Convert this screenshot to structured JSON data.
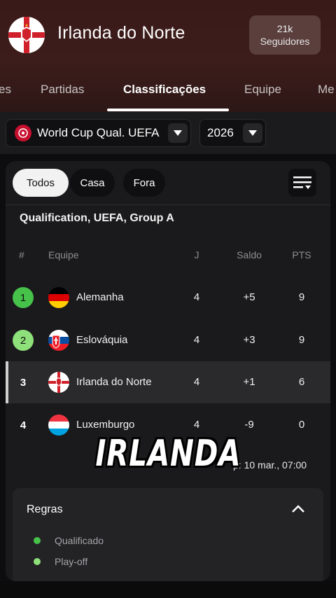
{
  "header": {
    "team_name": "Irlanda do Norte",
    "followers_count": "21k",
    "followers_label": "Seguidores"
  },
  "tabs": [
    {
      "label": "es",
      "active": false
    },
    {
      "label": "Partidas",
      "active": false
    },
    {
      "label": "Classificações",
      "active": true
    },
    {
      "label": "Equipe",
      "active": false
    },
    {
      "label": "Me",
      "active": false
    }
  ],
  "filters": {
    "competition": "World Cup Qual. UEFA",
    "season": "2026"
  },
  "chips": [
    "Todos",
    "Casa",
    "Fora"
  ],
  "group_title": "Qualification, UEFA, Group A",
  "table": {
    "headers": {
      "pos": "#",
      "team": "Equipe",
      "played": "J",
      "diff": "Saldo",
      "pts": "PTS"
    },
    "rows": [
      {
        "pos": "1",
        "team": "Alemanha",
        "played": "4",
        "diff": "+5",
        "pts": "9",
        "status": "qualified",
        "flag": "germany-flag"
      },
      {
        "pos": "2",
        "team": "Eslováquia",
        "played": "4",
        "diff": "+3",
        "pts": "9",
        "status": "playoff",
        "flag": "slovakia-flag"
      },
      {
        "pos": "3",
        "team": "Irlanda do Norte",
        "played": "4",
        "diff": "+1",
        "pts": "6",
        "status": "none",
        "flag": "northern-ireland-flag",
        "highlighted": true
      },
      {
        "pos": "4",
        "team": "Luxemburgo",
        "played": "4",
        "diff": "-9",
        "pts": "0",
        "status": "none",
        "flag": "luxembourg-flag"
      }
    ]
  },
  "next_match": "p: 10 mar., 07:00",
  "rules": {
    "title": "Regras",
    "legend": [
      {
        "label": "Qualificado",
        "color": "#46c24a"
      },
      {
        "label": "Play-off",
        "color": "#8ee07a"
      }
    ]
  },
  "caption": "IRLANDA",
  "colors": {
    "header_bg": "#3a1a19",
    "qualified": "#46c24a",
    "playoff": "#8ee07a"
  }
}
